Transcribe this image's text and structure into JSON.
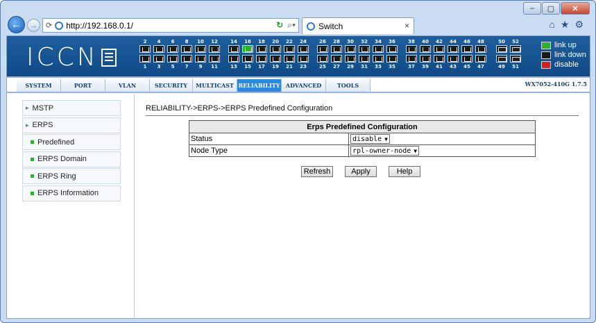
{
  "browser": {
    "url": "http://192.168.0.1/",
    "tab_title": "Switch",
    "window_controls": {
      "minimize": "–",
      "maximize": "▢",
      "close": "✕"
    }
  },
  "banner": {
    "logo": "ICCN",
    "ports_top": [
      "2",
      "4",
      "6",
      "8",
      "10",
      "12",
      "14",
      "16",
      "18",
      "20",
      "22",
      "24",
      "26",
      "28",
      "30",
      "32",
      "34",
      "36",
      "38",
      "40",
      "42",
      "44",
      "46",
      "48"
    ],
    "ports_bottom": [
      "1",
      "3",
      "5",
      "7",
      "9",
      "11",
      "13",
      "15",
      "17",
      "19",
      "21",
      "23",
      "25",
      "27",
      "29",
      "31",
      "33",
      "35",
      "37",
      "39",
      "41",
      "43",
      "45",
      "47"
    ],
    "sfp_top": [
      "50",
      "52"
    ],
    "sfp_bottom": [
      "49",
      "51"
    ],
    "legend": {
      "up": "link up",
      "down": "link down",
      "disable": "disable"
    },
    "colors": {
      "up": "#29b329",
      "down": "#1a1a1a",
      "disable": "#d42020"
    }
  },
  "menu": {
    "items": [
      "SYSTEM",
      "PORT",
      "VLAN",
      "SECURITY",
      "MULTICAST",
      "RELIABILITY",
      "ADVANCED",
      "TOOLS"
    ],
    "active": "RELIABILITY",
    "version": "WX7052-410G 1.7.5"
  },
  "leftnav": {
    "items": [
      {
        "label": "MSTP",
        "type": "section"
      },
      {
        "label": "ERPS",
        "type": "section"
      },
      {
        "label": "Predefined",
        "type": "sub"
      },
      {
        "label": "ERPS Domain",
        "type": "sub"
      },
      {
        "label": "ERPS Ring",
        "type": "sub"
      },
      {
        "label": "ERPS Information",
        "type": "sub"
      }
    ]
  },
  "main": {
    "breadcrumb": "RELIABILITY->ERPS->ERPS Predefined Configuration",
    "table_title": "Erps Predefined Configuration",
    "rows": [
      {
        "label": "Status",
        "value": "disable"
      },
      {
        "label": "Node Type",
        "value": "rpl-owner-node"
      }
    ],
    "buttons": {
      "refresh": "Refresh",
      "apply": "Apply",
      "help": "Help"
    }
  }
}
